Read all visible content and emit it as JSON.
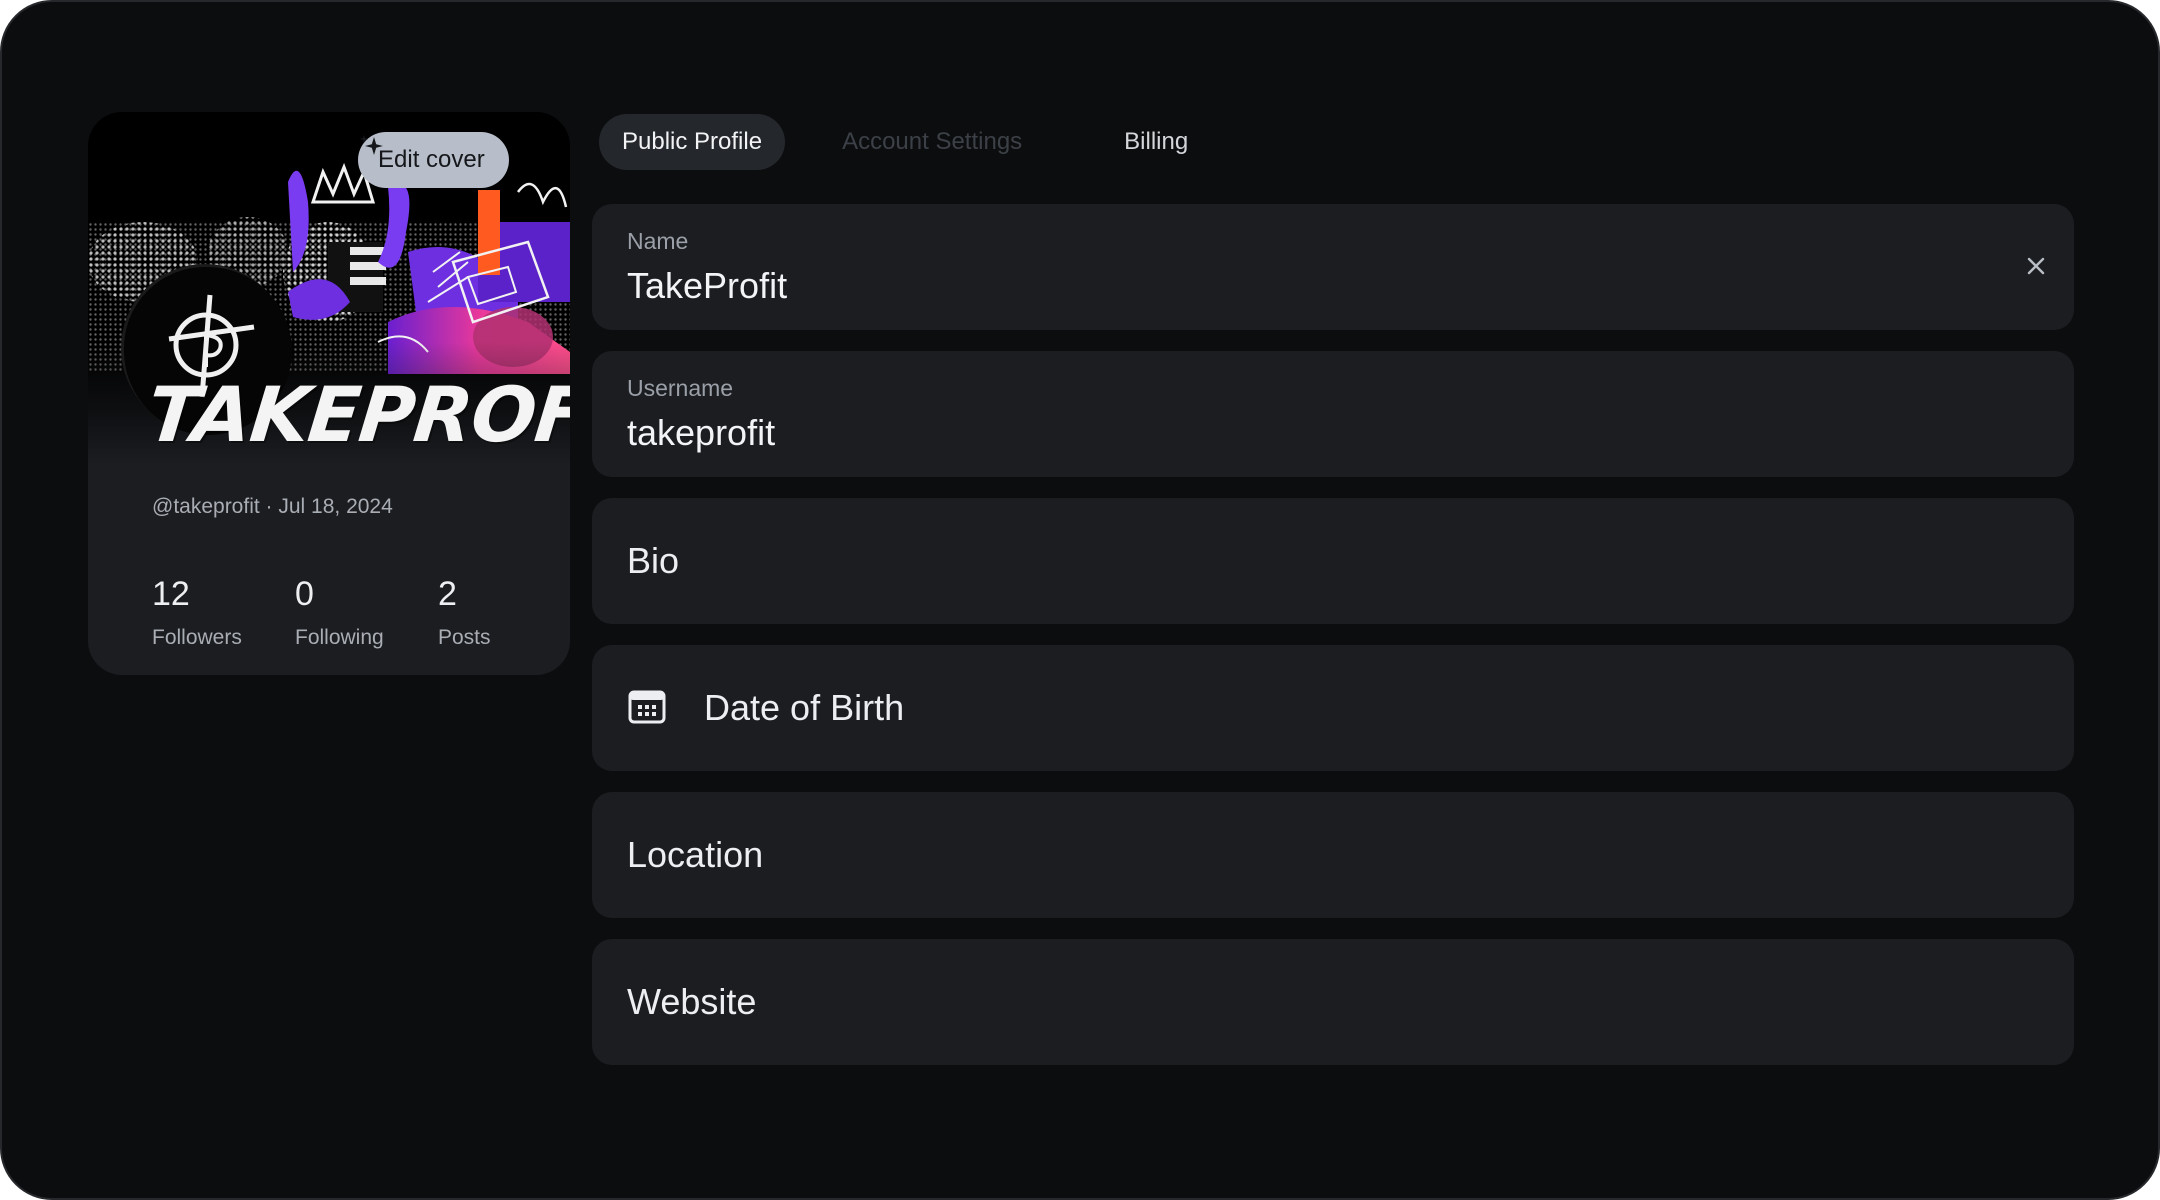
{
  "profile_card": {
    "edit_cover_label": "Edit cover",
    "brand_text": "TAKEPROFIT",
    "handle_date": "@takeprofit · Jul 18, 2024",
    "stats": [
      {
        "value": "12",
        "label": "Followers"
      },
      {
        "value": "0",
        "label": "Following"
      },
      {
        "value": "2",
        "label": "Posts"
      }
    ]
  },
  "tabs": [
    {
      "label": "Public Profile",
      "state": "active"
    },
    {
      "label": "Account Settings",
      "state": "disabled"
    },
    {
      "label": "Billing",
      "state": "normal"
    }
  ],
  "fields": {
    "name": {
      "label": "Name",
      "value": "TakeProfit"
    },
    "username": {
      "label": "Username",
      "value": "takeprofit"
    },
    "bio": {
      "placeholder": "Bio"
    },
    "dob": {
      "placeholder": "Date of Birth",
      "icon": "calendar-icon"
    },
    "location": {
      "placeholder": "Location"
    },
    "website": {
      "placeholder": "Website"
    }
  },
  "colors": {
    "background": "#0c0d0f",
    "surface": "#1b1d21",
    "edit_cover_button": "#b7bec9",
    "cover_accent_purple": "#7a3cf0",
    "cover_accent_pink": "#e8389a",
    "cover_accent_orange": "#ff5a1f"
  }
}
